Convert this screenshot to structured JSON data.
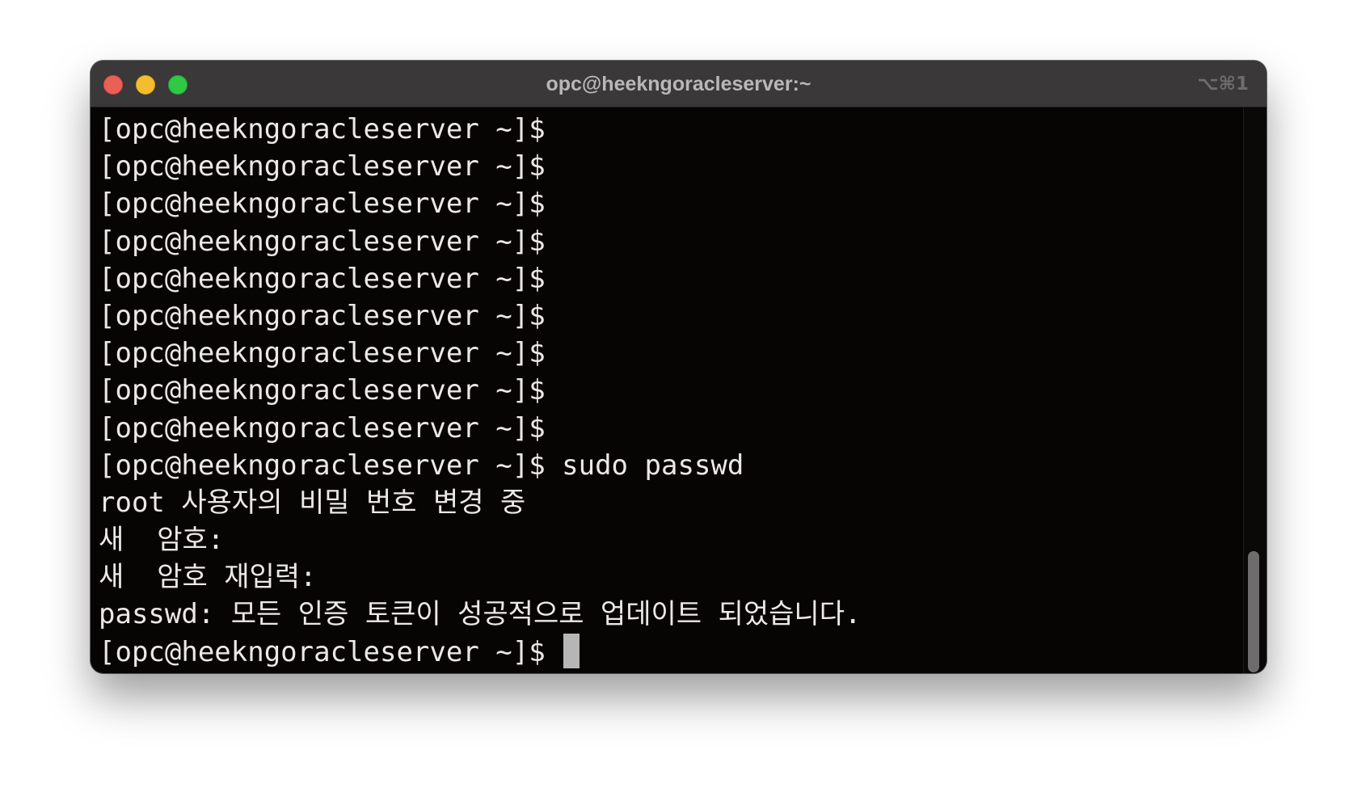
{
  "window": {
    "title": "opc@heekngoracleserver:~",
    "shortcut": "⌥⌘1"
  },
  "terminal": {
    "lines": [
      "[opc@heekngoracleserver ~]$",
      "[opc@heekngoracleserver ~]$",
      "[opc@heekngoracleserver ~]$",
      "[opc@heekngoracleserver ~]$",
      "[opc@heekngoracleserver ~]$",
      "[opc@heekngoracleserver ~]$",
      "[opc@heekngoracleserver ~]$",
      "[opc@heekngoracleserver ~]$",
      "[opc@heekngoracleserver ~]$",
      "[opc@heekngoracleserver ~]$ sudo passwd",
      "root 사용자의 비밀 번호 변경 중",
      "새  암호:",
      "새  암호 재입력:",
      "passwd: 모든 인증 토큰이 성공적으로 업데이트 되었습니다.",
      "[opc@heekngoracleserver ~]$ "
    ]
  },
  "colors": {
    "background": "#070404",
    "titlebar": "#3a3838",
    "text": "#ebe8e6",
    "close": "#ec5f57",
    "minimize": "#f4bd2f",
    "zoom": "#2fc946"
  }
}
